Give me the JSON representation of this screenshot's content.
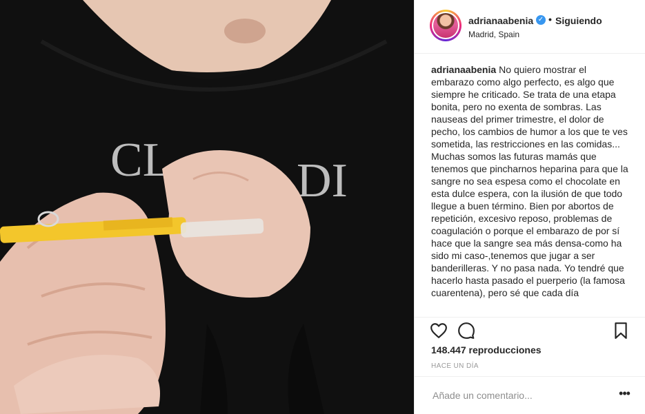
{
  "post": {
    "username": "adrianaabenia",
    "follow_status": "Siguiendo",
    "separator": "•",
    "location": "Madrid, Spain",
    "verified_icon": "verified-badge-icon",
    "verified_color": "#3897f0"
  },
  "caption": {
    "username": "adrianaabenia",
    "text": "No quiero mostrar el embarazo como algo perfecto, es algo que siempre he criticado. Se trata de una etapa bonita, pero no exenta de sombras. Las nauseas del primer trimestre, el dolor de pecho, los cambios de humor a los que te ves sometida, las restricciones en las comidas... Muchas somos las futuras mamás que tenemos que pincharnos heparina para que la sangre no sea espesa como el chocolate en esta dulce espera, con la ilusión de que todo llegue a buen término. Bien por abortos de repetición, excesivo reposo, problemas de coagulación o porque el embarazo de por sí hace que la sangre sea más densa-como ha sido mi caso-,tenemos que jugar a ser banderilleras. Y no pasa nada. Yo tendré que hacerlo hasta pasado el puerperio (la famosa cuarentena), pero sé que cada día"
  },
  "actions": {
    "like_icon": "heart-icon",
    "comment_icon": "comment-bubble-icon",
    "save_icon": "bookmark-icon"
  },
  "stats": {
    "views": "148.447 reproducciones",
    "timestamp": "HACE UN DÍA"
  },
  "comment_box": {
    "placeholder": "Añade un comentario...",
    "more_icon": "more-options-icon",
    "more_label": "•••"
  }
}
